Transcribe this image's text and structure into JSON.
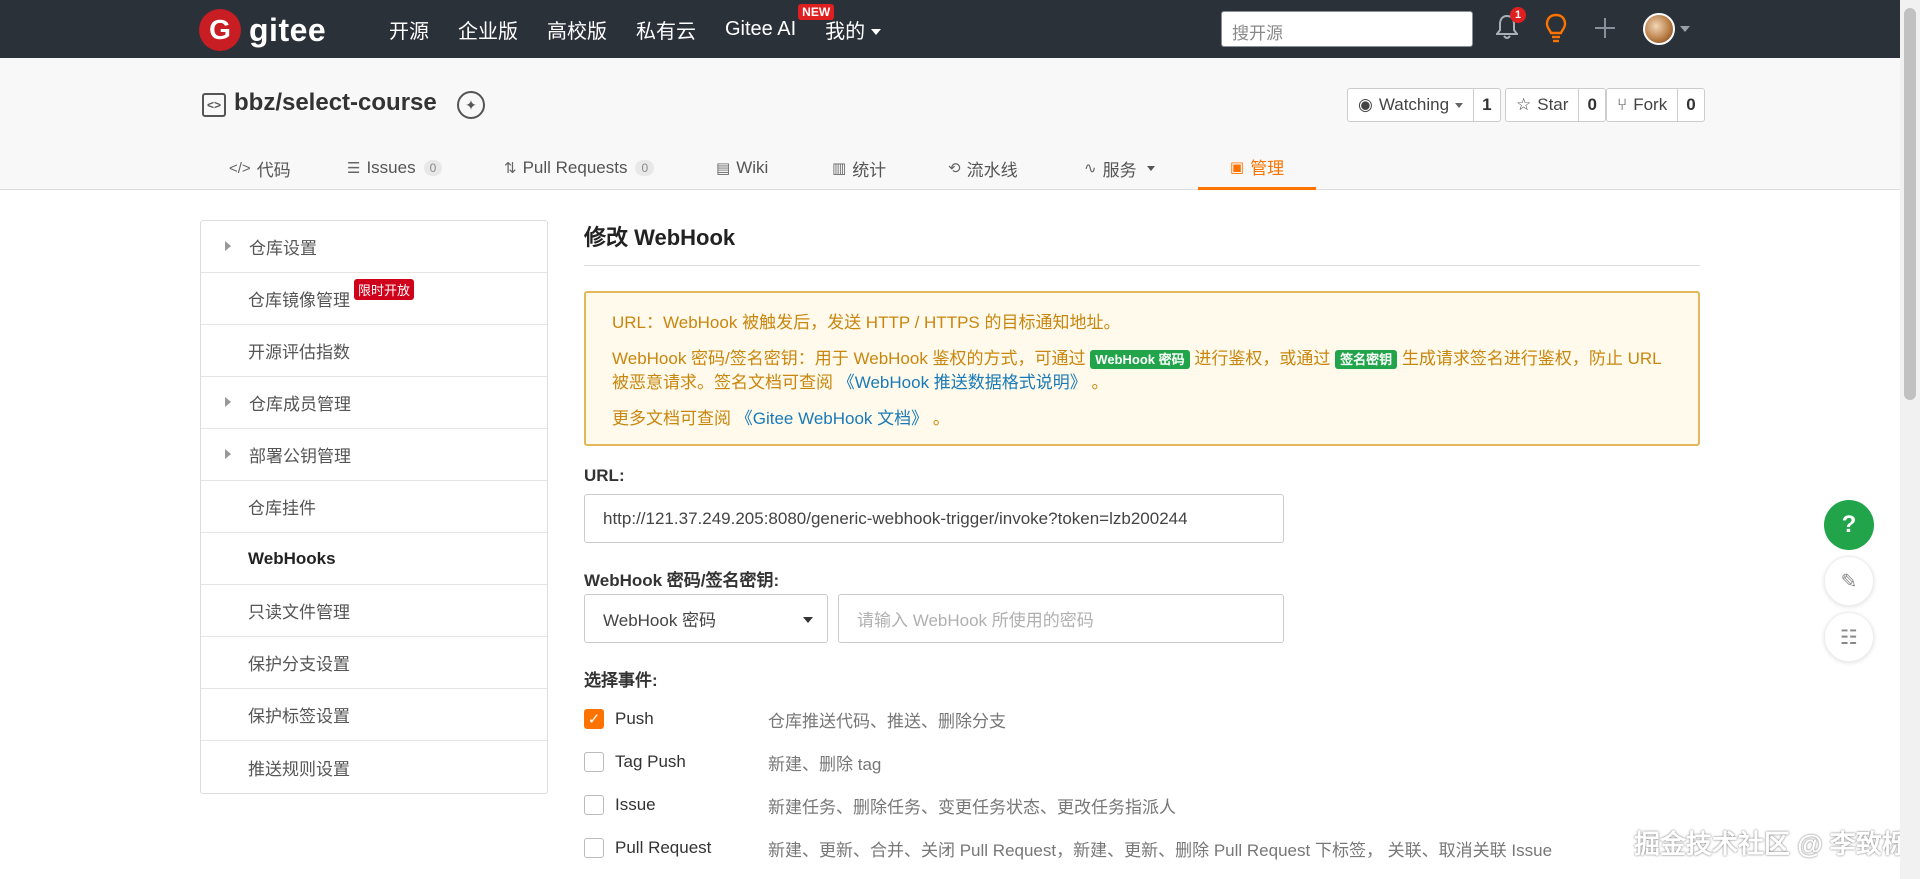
{
  "topnav": {
    "logo_mark": "G",
    "logo_text": "gitee",
    "links": [
      "开源",
      "企业版",
      "高校版",
      "私有云",
      "Gitee AI",
      "我的"
    ],
    "new_badge": "NEW",
    "search_placeholder": "搜开源",
    "notification_count": "1"
  },
  "repo": {
    "title": "bbz/select-course",
    "watch_label": "Watching",
    "watch_count": "1",
    "star_label": "Star",
    "star_count": "0",
    "fork_label": "Fork",
    "fork_count": "0",
    "tabs": [
      {
        "label": "代码",
        "icon": "code-icon"
      },
      {
        "label": "Issues",
        "count": "0",
        "icon": "issues-icon"
      },
      {
        "label": "Pull Requests",
        "count": "0",
        "icon": "pr-icon"
      },
      {
        "label": "Wiki",
        "icon": "wiki-icon"
      },
      {
        "label": "统计",
        "icon": "stats-icon"
      },
      {
        "label": "流水线",
        "icon": "pipeline-icon"
      },
      {
        "label": "服务",
        "icon": "service-icon"
      },
      {
        "label": "管理",
        "icon": "manage-icon"
      }
    ],
    "active_tab": "管理"
  },
  "sidebar": {
    "items": [
      {
        "label": "仓库设置"
      },
      {
        "label": "仓库镜像管理",
        "badge": "限时开放"
      },
      {
        "label": "开源评估指数"
      },
      {
        "label": "仓库成员管理"
      },
      {
        "label": "部署公钥管理"
      },
      {
        "label": "仓库挂件"
      },
      {
        "label": "WebHooks"
      },
      {
        "label": "只读文件管理"
      },
      {
        "label": "保护分支设置"
      },
      {
        "label": "保护标签设置"
      },
      {
        "label": "推送规则设置"
      }
    ],
    "active": "WebHooks"
  },
  "main": {
    "title": "修改 WebHook",
    "notice": {
      "line1": "URL：WebHook 被触发后，发送 HTTP / HTTPS 的目标通知地址。",
      "line2_a": "WebHook 密码/签名密钥：用于 WebHook 鉴权的方式，可通过",
      "tag1": "WebHook 密码",
      "line2_b": "进行鉴权，或通过",
      "tag2": "签名密钥",
      "line2_c": "生成请求签名进行鉴权，防止 URL 被恶意请求。签名文档可查阅",
      "link1": "《WebHook 推送数据格式说明》",
      "line2_end": "。",
      "line3_a": "更多文档可查阅",
      "link2": "《Gitee WebHook 文档》",
      "line3_end": "。"
    },
    "url_label": "URL:",
    "url_value": "http://121.37.249.205:8080/generic-webhook-trigger/invoke?token=lzb200244",
    "secret_label": "WebHook 密码/签名密钥:",
    "secret_type": "WebHook 密码",
    "secret_placeholder": "请输入 WebHook 所使用的密码",
    "events_label": "选择事件:",
    "events": [
      {
        "name": "Push",
        "desc": "仓库推送代码、推送、删除分支",
        "checked": true
      },
      {
        "name": "Tag Push",
        "desc": "新建、删除 tag",
        "checked": false
      },
      {
        "name": "Issue",
        "desc": "新建任务、删除任务、变更任务状态、更改任务指派人",
        "checked": false
      },
      {
        "name": "Pull Request",
        "desc": "新建、更新、合并、关闭 Pull Request，新建、更新、删除 Pull Request 下标签，  关联、取消关联 Issue",
        "checked": false
      }
    ]
  },
  "float": {
    "help": "?"
  },
  "watermark": "掘金技术社区 @ 李致栎",
  "colors": {
    "accent": "#fe7300",
    "nav_bg": "#2b3139",
    "brand": "#c71d23",
    "notice_text": "#c9860f",
    "link": "#1a7ab8",
    "green": "#21a44a"
  }
}
